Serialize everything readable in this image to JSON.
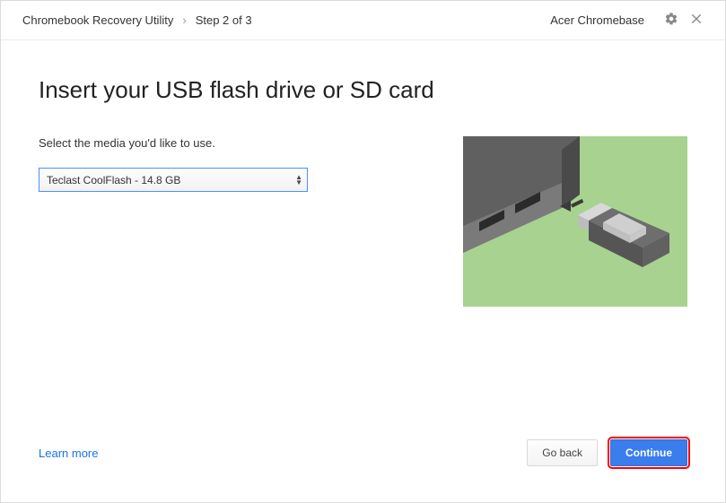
{
  "header": {
    "app_title": "Chromebook Recovery Utility",
    "separator": "›",
    "step_label": "Step 2 of 3",
    "device_name": "Acer Chromebase"
  },
  "main": {
    "title": "Insert your USB flash drive or SD card",
    "prompt": "Select the media you'd like to use.",
    "media_select": {
      "value": "Teclast CoolFlash - 14.8 GB"
    }
  },
  "footer": {
    "learn_more": "Learn more",
    "go_back": "Go back",
    "continue": "Continue"
  }
}
